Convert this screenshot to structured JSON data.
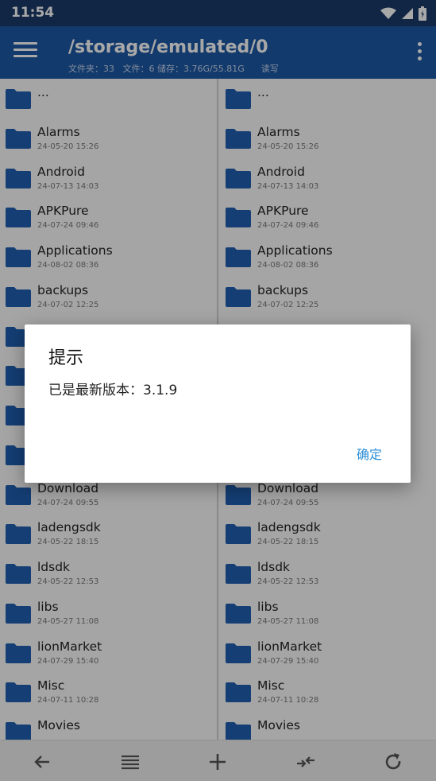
{
  "status": {
    "time": "11:54"
  },
  "header": {
    "path": "/storage/emulated/0",
    "folders_label": "文件夹：33",
    "files_label": "文件：6",
    "storage_label": "储存：3.76G/55.81G",
    "rw_label": "读写"
  },
  "left_pane": {
    "items": [
      {
        "name": "...",
        "date": ""
      },
      {
        "name": "Alarms",
        "date": "24-05-20 15:26"
      },
      {
        "name": "Android",
        "date": "24-07-13 14:03"
      },
      {
        "name": "APKPure",
        "date": "24-07-24 09:46"
      },
      {
        "name": "Applications",
        "date": "24-08-02 08:36"
      },
      {
        "name": "backups",
        "date": "24-07-02 12:25"
      },
      {
        "name": "",
        "date": ""
      },
      {
        "name": "",
        "date": ""
      },
      {
        "name": "",
        "date": ""
      },
      {
        "name": "",
        "date": ""
      },
      {
        "name": "Download",
        "date": "24-07-24 09:55"
      },
      {
        "name": "ladengsdk",
        "date": "24-05-22 18:15"
      },
      {
        "name": "ldsdk",
        "date": "24-05-22 12:53"
      },
      {
        "name": "libs",
        "date": "24-05-27 11:08"
      },
      {
        "name": "lionMarket",
        "date": "24-07-29 15:40"
      },
      {
        "name": "Misc",
        "date": "24-07-11 10:28"
      },
      {
        "name": "Movies",
        "date": ""
      }
    ]
  },
  "right_pane": {
    "items": [
      {
        "name": "...",
        "date": ""
      },
      {
        "name": "Alarms",
        "date": "24-05-20 15:26"
      },
      {
        "name": "Android",
        "date": "24-07-13 14:03"
      },
      {
        "name": "APKPure",
        "date": "24-07-24 09:46"
      },
      {
        "name": "Applications",
        "date": "24-08-02 08:36"
      },
      {
        "name": "backups",
        "date": "24-07-02 12:25"
      },
      {
        "name": "",
        "date": ""
      },
      {
        "name": "",
        "date": ""
      },
      {
        "name": "",
        "date": ""
      },
      {
        "name": "",
        "date": ""
      },
      {
        "name": "Download",
        "date": "24-07-24 09:55"
      },
      {
        "name": "ladengsdk",
        "date": "24-05-22 18:15"
      },
      {
        "name": "ldsdk",
        "date": "24-05-22 12:53"
      },
      {
        "name": "libs",
        "date": "24-05-27 11:08"
      },
      {
        "name": "lionMarket",
        "date": "24-07-29 15:40"
      },
      {
        "name": "Misc",
        "date": "24-07-11 10:28"
      },
      {
        "name": "Movies",
        "date": ""
      }
    ]
  },
  "dialog": {
    "title": "提示",
    "message": "已是最新版本：3.1.9",
    "ok_label": "确定"
  },
  "bottom_bar": {
    "icons": [
      "back-arrow-icon",
      "list-view-icon",
      "add-icon",
      "swap-panes-icon",
      "refresh-icon"
    ]
  },
  "colors": {
    "status_bar": "#1a3a6a",
    "app_bar": "#1d59a5",
    "folder": "#1f5fb0",
    "dialog_button": "#2d8fd6"
  }
}
